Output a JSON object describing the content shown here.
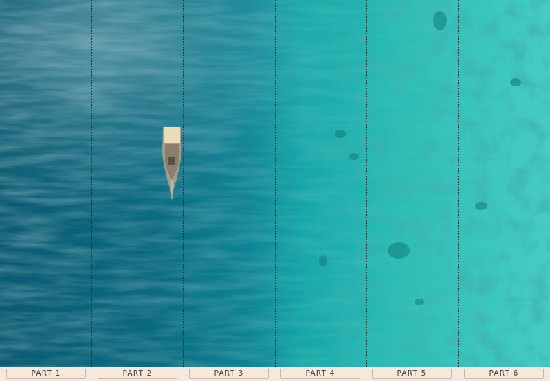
{
  "scene": {
    "description_colors": {
      "deep_water": "#0a5a72",
      "mid_water": "#0f8a98",
      "shallow_water": "#2fc4bd",
      "reef_patch": "#1f8f88",
      "divider_line": "#1a1a1a",
      "label_bg": "#f7e8dc",
      "label_border": "#cdb8a6"
    },
    "boat": {
      "icon": "boat-icon",
      "deck_color": "#e9d7b6",
      "hull_color": "#b8b0a0"
    }
  },
  "panels": [
    {
      "label": "PART 1"
    },
    {
      "label": "PART 2"
    },
    {
      "label": "PART 3"
    },
    {
      "label": "PART 4"
    },
    {
      "label": "PART 5"
    },
    {
      "label": "PART 6"
    }
  ]
}
